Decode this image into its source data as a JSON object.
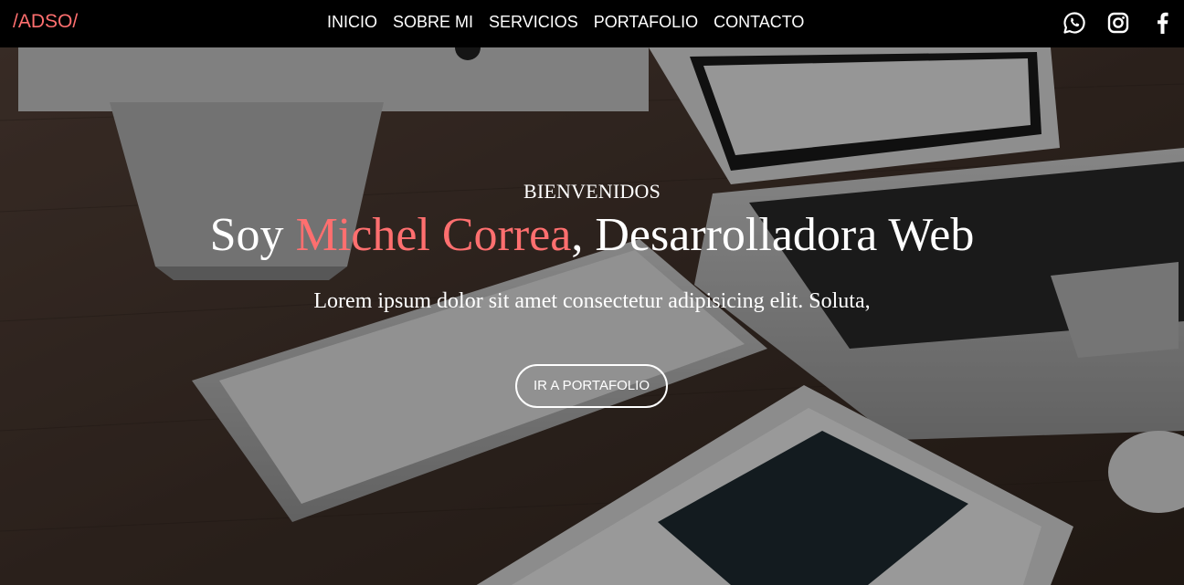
{
  "brand": {
    "logo": "/ADSO/",
    "accent_color": "#ff6f6f"
  },
  "nav": {
    "items": [
      {
        "label": "INICIO"
      },
      {
        "label": "SOBRE MI"
      },
      {
        "label": "SERVICIOS"
      },
      {
        "label": "PORTAFOLIO"
      },
      {
        "label": "CONTACTO"
      }
    ]
  },
  "social": [
    {
      "icon": "whatsapp-icon"
    },
    {
      "icon": "instagram-icon"
    },
    {
      "icon": "facebook-icon"
    }
  ],
  "hero": {
    "welcome": "BIENVENIDOS",
    "headline_prefix": "Soy ",
    "headline_name": "Michel Correa",
    "headline_suffix": ", Desarrolladora Web",
    "lead": "Lorem ipsum dolor sit amet consectetur adipisicing elit. Soluta,",
    "cta_label": "IR A PORTAFOLIO",
    "background_image": "desk-with-imac-keyboard-macbook-ipad"
  }
}
